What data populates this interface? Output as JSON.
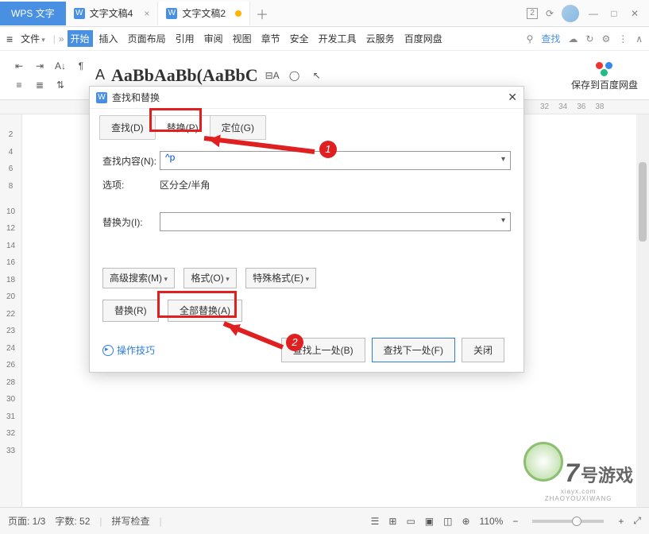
{
  "titlebar": {
    "appname": "WPS 文字",
    "tabs": [
      {
        "label": "文字文稿4",
        "active": false,
        "modified": false
      },
      {
        "label": "文字文稿2",
        "active": true,
        "modified": true
      }
    ],
    "badge": "2"
  },
  "menubar": {
    "file": "文件",
    "items": [
      "开始",
      "插入",
      "页面布局",
      "引用",
      "审阅",
      "视图",
      "章节",
      "安全",
      "开发工具",
      "云服务",
      "百度网盘"
    ],
    "search": "查找",
    "search_icon": "⚲"
  },
  "ribbon": {
    "style_preview": "AaBbAaBb(AaBbC",
    "baidu_label": "保存到百度网盘"
  },
  "ruler_h": [
    "32",
    "34",
    "36",
    "38"
  ],
  "ruler_v": [
    "2",
    "4",
    "6",
    "8",
    "",
    "10",
    "12",
    "14",
    "16",
    "18",
    "20",
    "22",
    "23",
    "24",
    "26",
    "28",
    "30",
    "31",
    "32",
    "33"
  ],
  "dialog": {
    "title": "查找和替换",
    "tabs": {
      "find": "查找(D)",
      "replace": "替换(P)",
      "goto": "定位(G)"
    },
    "find_label": "查找内容(N):",
    "find_value": "^p",
    "options_label": "选项:",
    "options_value": "区分全/半角",
    "replace_label": "替换为(I):",
    "replace_value": "",
    "adv_search": "高级搜索(M)",
    "format": "格式(O)",
    "special": "特殊格式(E)",
    "btn_replace": "替换(R)",
    "btn_replace_all": "全部替换(A)",
    "tips": "操作技巧",
    "find_prev": "查找上一处(B)",
    "find_next": "查找下一处(F)",
    "close": "关闭"
  },
  "annotations": {
    "b1": "1",
    "b2": "2"
  },
  "statusbar": {
    "page": "页面: 1/3",
    "words": "字数: 52",
    "spellcheck": "拼写检查",
    "zoom": "110%"
  },
  "watermark": {
    "num": "7",
    "cn": "号游戏",
    "sub": "xiayx.com",
    "tag": "ZHAOYOUXIWANG"
  }
}
